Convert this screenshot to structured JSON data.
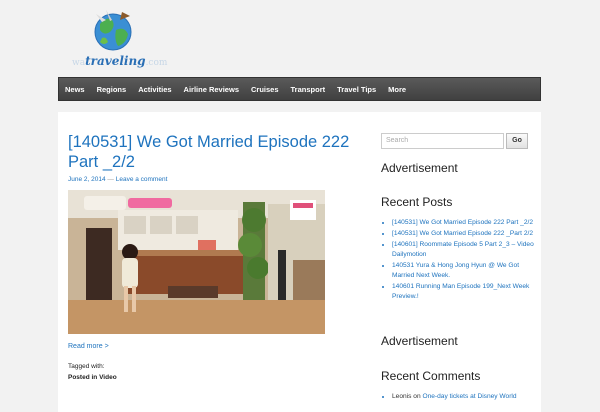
{
  "logo": {
    "prefix": "wa",
    "word": "traveling",
    "suffix": ".com"
  },
  "nav": [
    "News",
    "Regions",
    "Activities",
    "Airline Reviews",
    "Cruises",
    "Transport",
    "Travel Tips",
    "More"
  ],
  "post": {
    "title": "[140531] We Got Married Episode 222 Part _2/2",
    "date": "June 2, 2014",
    "separator": "—",
    "comment_link": "Leave a comment",
    "read_more": "Read more >",
    "tagged_with": "Tagged with:",
    "posted_in_label": "Posted in",
    "category": "Video"
  },
  "sidebar": {
    "search_placeholder": "Search",
    "search_button": "Go",
    "advertisement_1": "Advertisement",
    "recent_posts_title": "Recent Posts",
    "recent_posts": [
      "[140531] We Got Married Episode 222 Part _2/2",
      "[140531] We Got Married Episode 222 _Part 2/2",
      "[140601] Roommate Episode 5 Part 2_3 – Video Dailymotion",
      "140531 Yura & Hong Jong Hyun @ We Got Married Next Week.",
      "140601 Running Man Episode 199_Next Week Preview.!"
    ],
    "advertisement_2": "Advertisement",
    "recent_comments_title": "Recent Comments",
    "recent_comments": [
      {
        "author": "Leonis",
        "on": "on",
        "link": "One-day tickets at Disney World"
      }
    ]
  },
  "colors": {
    "link": "#1e73be",
    "nav_bg": "#4a4a4a",
    "page_bg": "#f2f2f2"
  }
}
